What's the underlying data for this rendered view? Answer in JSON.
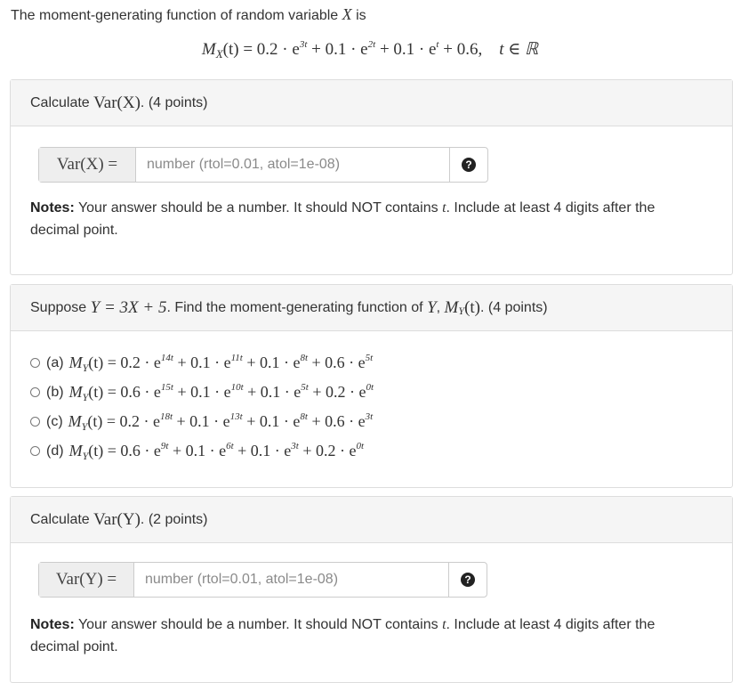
{
  "intro": {
    "text": "The moment-generating function of random variable",
    "var": "X",
    "suffix": "is"
  },
  "display_equation": {
    "lhs": "M",
    "lhs_sub": "X",
    "arg": "(t) = 0.2 · e",
    "terms": [
      "3t",
      "+ 0.1 · e",
      "2t",
      "+ 0.1 · e",
      "t",
      "+ 0.6,",
      "t ∈ ℝ"
    ]
  },
  "q1": {
    "header_prefix": "Calculate",
    "header_math": "Var(X)",
    "header_suffix": ". (4 points)",
    "input_label": "Var(X) =",
    "placeholder": "number (rtol=0.01, atol=1e-08)",
    "help_icon": "question-circle-icon",
    "notes_bold": "Notes:",
    "notes_text_1": " Your answer should be a number. It should NOT contains ",
    "notes_var": "t",
    "notes_text_2": ". Include at least 4 digits after the decimal point."
  },
  "q2": {
    "header_prefix": "Suppose",
    "header_eq": "Y = 3X + 5",
    "header_mid": ". Find the moment-generating function of",
    "header_y": "Y",
    "header_m": "M",
    "header_m_sub": "Y",
    "header_m_arg": "(t)",
    "header_suffix": ". (4 points)",
    "options": [
      {
        "label": "(a)",
        "lhs": "M",
        "sub": "Y",
        "body": [
          "(t) = 0.2 · e",
          "14t",
          " + 0.1 · e",
          "11t",
          " + 0.1 · e",
          "8t",
          " + 0.6 · e",
          "5t"
        ]
      },
      {
        "label": "(b)",
        "lhs": "M",
        "sub": "Y",
        "body": [
          "(t) = 0.6 · e",
          "15t",
          " + 0.1 · e",
          "10t",
          " + 0.1 · e",
          "5t",
          " + 0.2 · e",
          "0t"
        ]
      },
      {
        "label": "(c)",
        "lhs": "M",
        "sub": "Y",
        "body": [
          "(t) = 0.2 · e",
          "18t",
          " + 0.1 · e",
          "13t",
          " + 0.1 · e",
          "8t",
          " + 0.6 · e",
          "3t"
        ]
      },
      {
        "label": "(d)",
        "lhs": "M",
        "sub": "Y",
        "body": [
          "(t) = 0.6 · e",
          "9t",
          " + 0.1 · e",
          "6t",
          " + 0.1 · e",
          "3t",
          " + 0.2 · e",
          "0t"
        ]
      }
    ]
  },
  "q3": {
    "header_prefix": "Calculate",
    "header_math": "Var(Y)",
    "header_suffix": ". (2 points)",
    "input_label": "Var(Y) =",
    "placeholder": "number (rtol=0.01, atol=1e-08)",
    "help_icon": "question-circle-icon",
    "notes_bold": "Notes:",
    "notes_text_1": " Your answer should be a number. It should NOT contains ",
    "notes_var": "t",
    "notes_text_2": ". Include at least 4 digits after the decimal point."
  }
}
